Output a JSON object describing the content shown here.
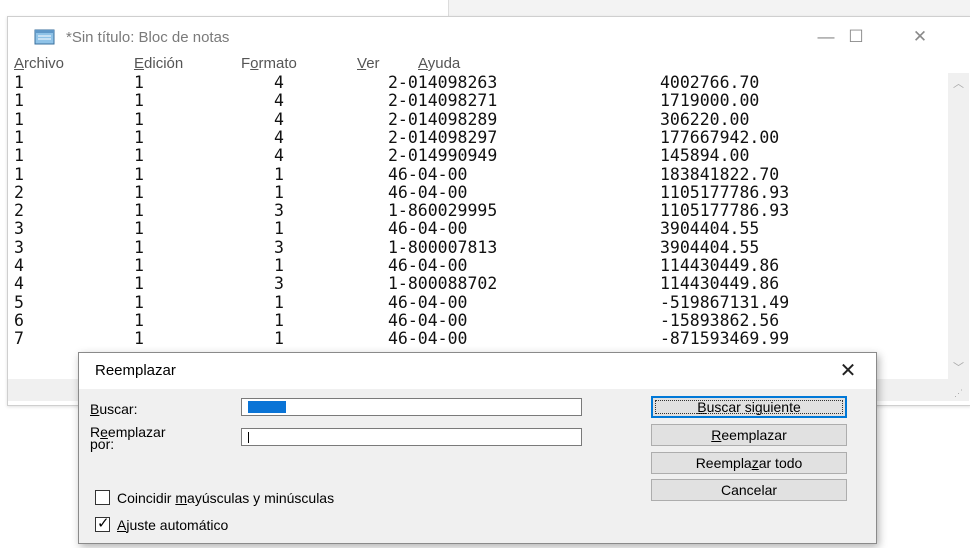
{
  "notepad": {
    "title": "*Sin título: Bloc de notas",
    "controls": {
      "minimize": "—",
      "maximize": "☐",
      "close": "✕"
    },
    "menu": [
      {
        "prefix": "",
        "accel": "A",
        "rest": "rchivo"
      },
      {
        "prefix": "",
        "accel": "E",
        "rest": "dición"
      },
      {
        "prefix": "F",
        "accel": "o",
        "rest": "rmato"
      },
      {
        "prefix": "",
        "accel": "V",
        "rest": "er"
      },
      {
        "prefix": "",
        "accel": "A",
        "rest": "yuda"
      }
    ],
    "rows": [
      [
        "1",
        "1",
        "4",
        "2-014098263",
        "4002766.70"
      ],
      [
        "1",
        "1",
        "4",
        "2-014098271",
        "1719000.00"
      ],
      [
        "1",
        "1",
        "4",
        "2-014098289",
        "306220.00"
      ],
      [
        "1",
        "1",
        "4",
        "2-014098297",
        "177667942.00"
      ],
      [
        "1",
        "1",
        "4",
        "2-014990949",
        "145894.00"
      ],
      [
        "1",
        "1",
        "1",
        "46-04-00",
        "183841822.70"
      ],
      [
        "2",
        "1",
        "1",
        "46-04-00",
        "1105177786.93"
      ],
      [
        "2",
        "1",
        "3",
        "1-860029995",
        "1105177786.93"
      ],
      [
        "3",
        "1",
        "1",
        "46-04-00",
        "3904404.55"
      ],
      [
        "3",
        "1",
        "3",
        "1-800007813",
        "3904404.55"
      ],
      [
        "4",
        "1",
        "1",
        "46-04-00",
        "114430449.86"
      ],
      [
        "4",
        "1",
        "3",
        "1-800088702",
        "114430449.86"
      ],
      [
        "5",
        "1",
        "1",
        "46-04-00",
        "-519867131.49"
      ],
      [
        "6",
        "1",
        "1",
        "46-04-00",
        "-15893862.56"
      ],
      [
        "7",
        "1",
        "1",
        "46-04-00",
        "-871593469.99"
      ]
    ]
  },
  "dialog": {
    "title": "Reemplazar",
    "close": "✕",
    "find_label": {
      "accel": "B",
      "rest": "uscar:"
    },
    "replace_label": {
      "pre": "R",
      "accel": "e",
      "rest": "emplazar",
      "line2": "por:"
    },
    "find_value": "",
    "replace_value": "",
    "buttons": {
      "find_next": {
        "accel": "B",
        "rest": "uscar siguiente"
      },
      "replace": {
        "accel": "R",
        "rest": "eemplazar"
      },
      "replace_all": {
        "pre": "Reempla",
        "accel": "z",
        "rest": "ar todo"
      },
      "cancel": "Cancelar"
    },
    "match_case": {
      "pre": "Coincidir ",
      "accel": "m",
      "rest": "ayúsculas y minúsculas",
      "checked": false
    },
    "wrap": {
      "pre": "",
      "accel": "A",
      "rest": "juste automático",
      "checked": true
    }
  }
}
